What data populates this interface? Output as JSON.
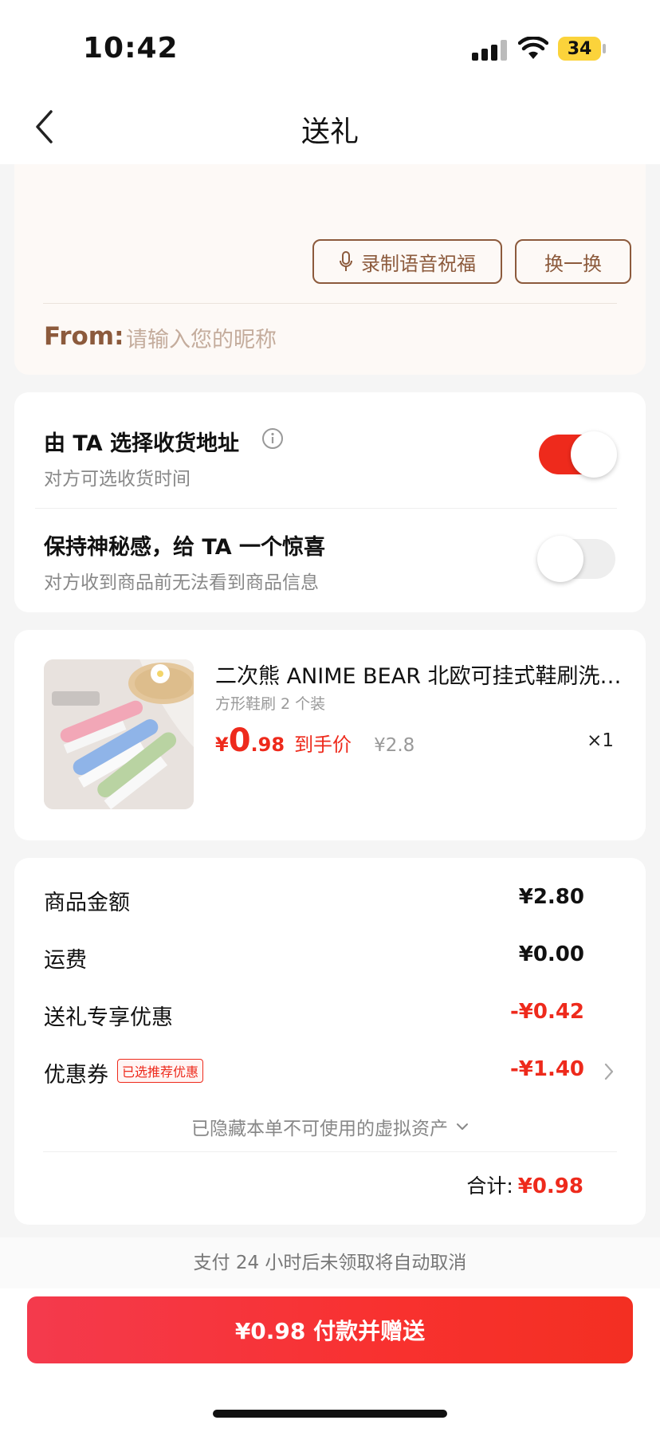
{
  "status_bar": {
    "time": "10:42",
    "battery": "34"
  },
  "nav": {
    "title": "送礼"
  },
  "message": {
    "voice_button": "录制语音祝福",
    "change_button": "换一换",
    "from_label": "From:",
    "nickname_placeholder": "请输入您的昵称"
  },
  "options": {
    "address": {
      "title": "由 TA 选择收货地址",
      "subtitle": "对方可选收货时间",
      "enabled": true
    },
    "surprise": {
      "title": "保持神秘感，给 TA 一个惊喜",
      "subtitle": "对方收到商品前无法看到商品信息",
      "enabled": false
    }
  },
  "product": {
    "name": "二次熊 ANIME BEAR 北欧可挂式鞋刷洗鞋刷",
    "spec": "方形鞋刷 2 个装",
    "price_symbol": "¥",
    "price_int": "0",
    "price_dec": ".98",
    "price_tag": "到手价",
    "original_price": "¥2.8",
    "quantity": "×1"
  },
  "summary": {
    "rows": [
      {
        "label": "商品金额",
        "value": "¥2.80"
      },
      {
        "label": "运费",
        "value": "¥0.00"
      },
      {
        "label": "送礼专享优惠",
        "value": "-¥0.42"
      },
      {
        "label": "优惠券",
        "value": "-¥1.40",
        "badge": "已选推荐优惠"
      }
    ],
    "hidden_assets": "已隐藏本单不可使用的虚拟资产",
    "total_label": "合计:",
    "total_value": "¥0.98"
  },
  "notice": "支付 24 小时后未领取将自动取消",
  "pay_button": "¥0.98 付款并赠送",
  "colors": {
    "accent_red": "#ee2a1c",
    "brown": "#8c5a3c"
  }
}
